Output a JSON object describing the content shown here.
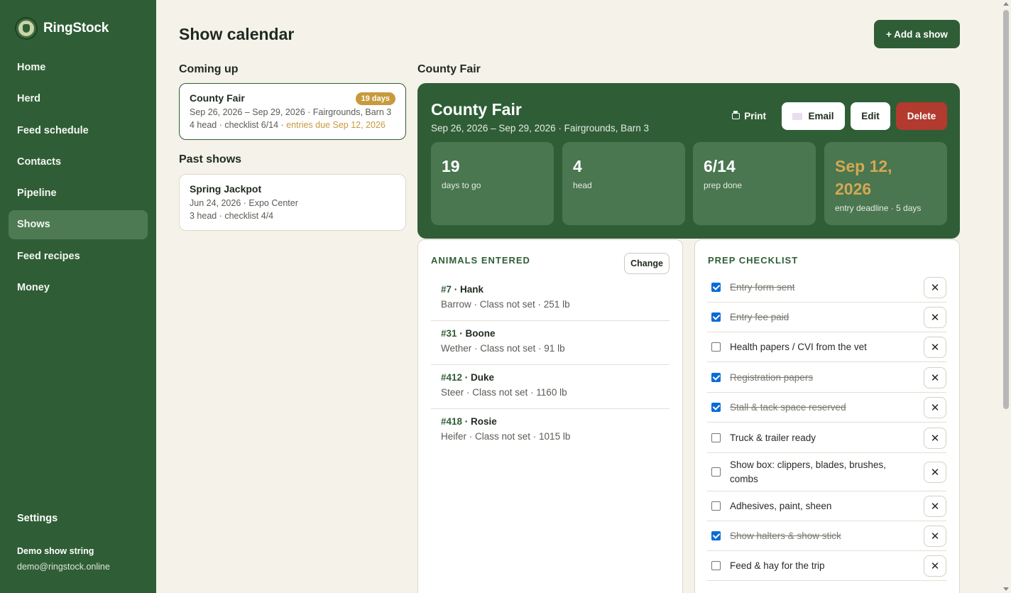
{
  "brand": {
    "name": "RingStock"
  },
  "nav": {
    "items": [
      {
        "label": "Home"
      },
      {
        "label": "Herd"
      },
      {
        "label": "Feed schedule"
      },
      {
        "label": "Contacts"
      },
      {
        "label": "Pipeline"
      },
      {
        "label": "Shows",
        "active": true
      },
      {
        "label": "Feed recipes"
      },
      {
        "label": "Money"
      }
    ],
    "settings": "Settings"
  },
  "user": {
    "name": "Demo show string",
    "email": "demo@ringstock.online"
  },
  "page": {
    "title": "Show calendar",
    "add_button": "+ Add a show"
  },
  "coming_up": {
    "heading": "Coming up",
    "shows": [
      {
        "title": "County Fair",
        "badge": "19 days",
        "line1": "Sep 26, 2026 – Sep 29, 2026 · Fairgrounds, Barn 3",
        "line2": "4 head · checklist 6/14 · ",
        "deadline": "entries due Sep 12, 2026"
      }
    ]
  },
  "past": {
    "heading": "Past shows",
    "shows": [
      {
        "title": "Spring Jackpot",
        "line1": "Jun 24, 2026 · Expo Center",
        "line2": "3 head · checklist 4/4"
      }
    ]
  },
  "detail": {
    "heading": "County Fair",
    "title": "County Fair",
    "subtitle": "Sep 26, 2026 – Sep 29, 2026 · Fairgrounds, Barn 3",
    "actions": {
      "print": "Print",
      "email": "Email",
      "edit": "Edit",
      "delete": "Delete"
    },
    "stats": [
      {
        "value": "19",
        "label": "days to go"
      },
      {
        "value": "4",
        "label": "head"
      },
      {
        "value": "6/14",
        "label": "prep done"
      },
      {
        "value": "Sep 12, 2026",
        "label": "entry deadline · 5 days",
        "highlight": "#d4a853"
      }
    ]
  },
  "animals": {
    "heading": "ANIMALS ENTERED",
    "change": "Change",
    "items": [
      {
        "tag": "#7",
        "name": "Hank",
        "meta": "Barrow · Class not set · 251 lb"
      },
      {
        "tag": "#31",
        "name": "Boone",
        "meta": "Wether · Class not set · 91 lb"
      },
      {
        "tag": "#412",
        "name": "Duke",
        "meta": "Steer · Class not set · 1160 lb"
      },
      {
        "tag": "#418",
        "name": "Rosie",
        "meta": "Heifer · Class not set · 1015 lb"
      }
    ]
  },
  "checklist": {
    "heading": "PREP CHECKLIST",
    "items": [
      {
        "label": "Entry form sent",
        "done": true
      },
      {
        "label": "Entry fee paid",
        "done": true
      },
      {
        "label": "Health papers / CVI from the vet",
        "done": false
      },
      {
        "label": "Registration papers",
        "done": true
      },
      {
        "label": "Stall & tack space reserved",
        "done": true
      },
      {
        "label": "Truck & trailer ready",
        "done": false
      },
      {
        "label": "Show box: clippers, blades, brushes, combs",
        "done": false
      },
      {
        "label": "Adhesives, paint, sheen",
        "done": false
      },
      {
        "label": "Show halters & show stick",
        "done": true
      },
      {
        "label": "Feed & hay for the trip",
        "done": false
      }
    ]
  },
  "colors": {
    "sidebar": "#2f5e36",
    "accent_gold": "#c89a3d",
    "delete": "#b23a2e",
    "checkbox": "#0b6bd6"
  }
}
